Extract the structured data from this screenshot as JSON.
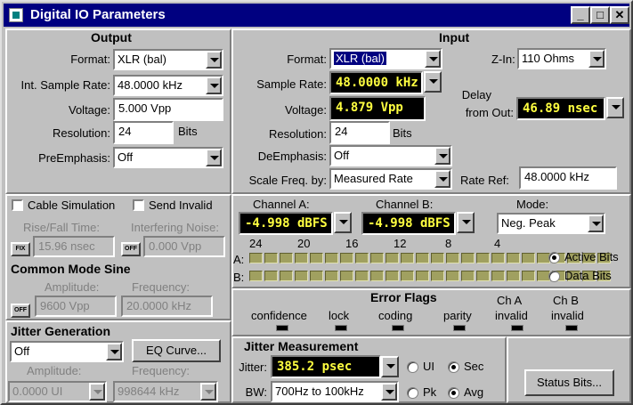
{
  "window": {
    "title": "Digital IO Parameters",
    "min": "_",
    "max": "□",
    "close": "✕"
  },
  "output": {
    "title": "Output",
    "format_label": "Format:",
    "format": "XLR (bal)",
    "rate_label": "Int. Sample Rate:",
    "rate": "48.0000 kHz",
    "voltage_label": "Voltage:",
    "voltage": "5.000   Vpp",
    "resolution_label": "Resolution:",
    "resolution": "24",
    "bits": "Bits",
    "preemph_label": "PreEmphasis:",
    "preemph": "Off",
    "cable_sim": "Cable Simulation",
    "send_invalid": "Send Invalid",
    "rise_label": "Rise/Fall Time:",
    "rise": "15.96  nsec",
    "fix": "FIX",
    "noise_label": "Interfering Noise:",
    "noise": "0.000  Vpp",
    "off1": "OFF",
    "cms_title": "Common Mode Sine",
    "off2": "OFF",
    "cms_amp_label": "Amplitude:",
    "cms_amp": "9600   Vpp",
    "cms_freq_label": "Frequency:",
    "cms_freq": "20.0000 kHz",
    "jitter_title": "Jitter Generation",
    "jitter": "Off",
    "eq_curve": "EQ Curve...",
    "jg_amp_label": "Amplitude:",
    "jg_amp": "0.0000  UI",
    "jg_freq_label": "Frequency:",
    "jg_freq": "998644 kHz"
  },
  "input": {
    "title": "Input",
    "format_label": "Format:",
    "format": "XLR (bal)",
    "zin_label": "Z-In:",
    "zin": "110 Ohms",
    "rate_label": "Sample Rate:",
    "rate": "48.0000 kHz",
    "delay_label1": "Delay",
    "delay_label2": "from Out:",
    "delay": "46.89  nsec",
    "voltage_label": "Voltage:",
    "voltage": "4.879   Vpp",
    "resolution_label": "Resolution:",
    "resolution": "24",
    "bits": "Bits",
    "deemph_label": "DeEmphasis:",
    "deemph": "Off",
    "scale_label": "Scale Freq. by:",
    "scale": "Measured Rate",
    "rateref_label": "Rate Ref:",
    "rateref": "48.0000 kHz",
    "cha_label": "Channel A:",
    "cha": "-4.998  dBFS",
    "chb_label": "Channel B:",
    "chb": "-4.998  dBFS",
    "mode_label": "Mode:",
    "mode": "Neg. Peak",
    "bit_ticks": [
      "24",
      "20",
      "16",
      "12",
      "8",
      "4"
    ],
    "row_a": "A:",
    "row_b": "B:",
    "active_bits": "Active Bits",
    "data_bits": "Data Bits",
    "flags_title": "Error Flags",
    "flags": [
      "confidence",
      "lock",
      "coding",
      "parity"
    ],
    "cha_invalid1": "Ch A",
    "cha_invalid2": "invalid",
    "chb_invalid1": "Ch B",
    "chb_invalid2": "invalid",
    "jm_title": "Jitter Measurement",
    "jitter_label": "Jitter:",
    "jitter": "385.2   psec",
    "ui": "UI",
    "sec": "Sec",
    "bw_label": "BW:",
    "bw": "700Hz to 100kHz",
    "pk": "Pk",
    "avg": "Avg",
    "status_bits": "Status Bits..."
  },
  "colors": {
    "lcd_bg": "#000000",
    "lcd_text": "#ffff40",
    "title_bar": "#000080"
  }
}
